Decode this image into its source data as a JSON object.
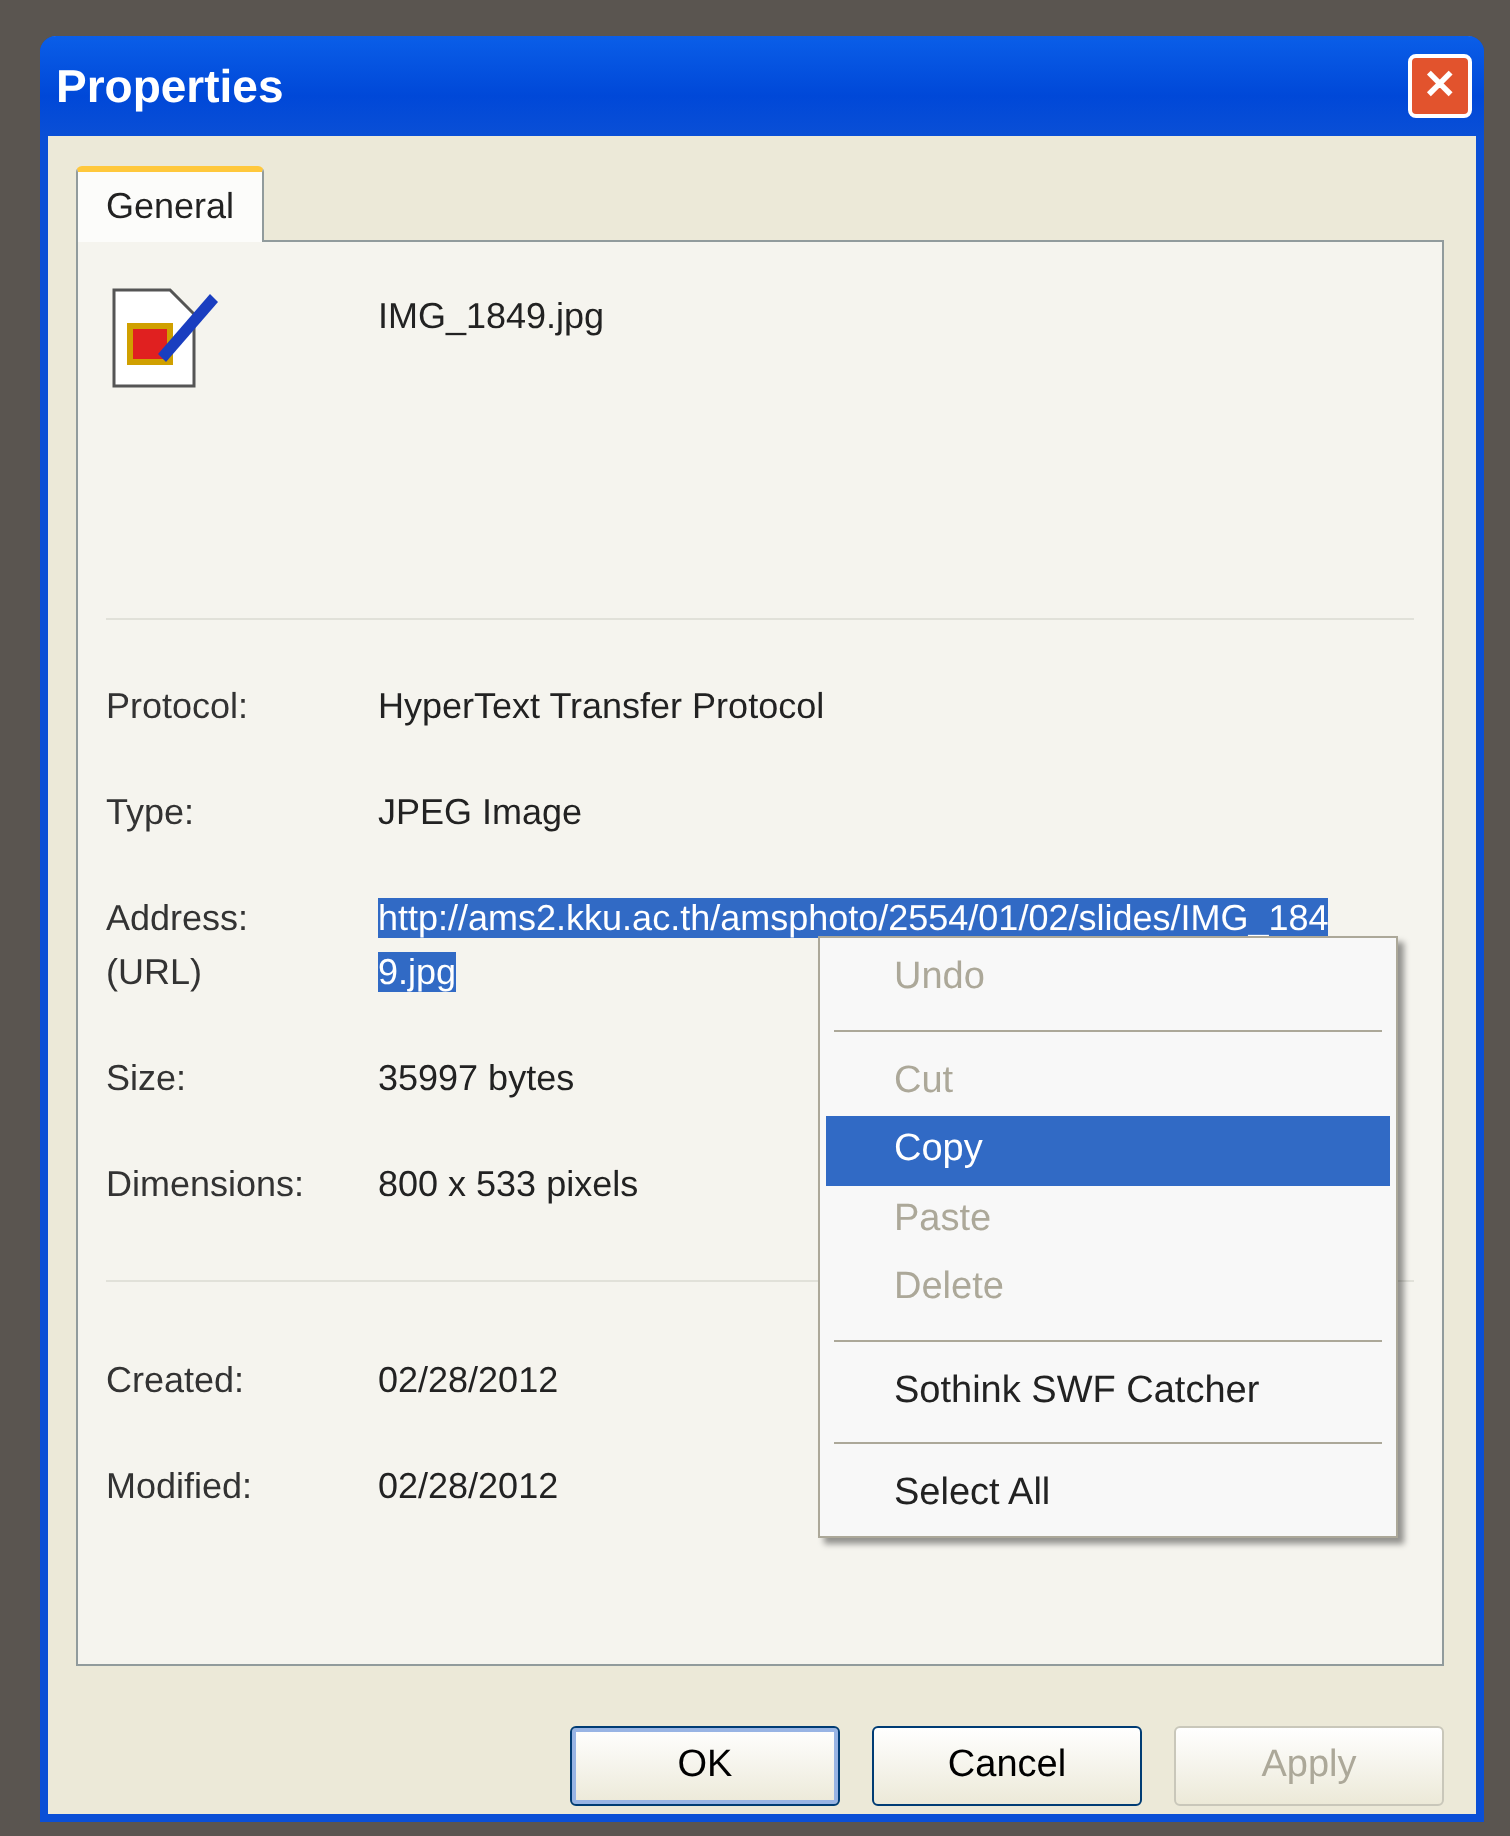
{
  "window": {
    "title": "Properties",
    "close": "✕"
  },
  "tabs": [
    {
      "label": "General",
      "selected": true
    }
  ],
  "file": {
    "name": "IMG_1849.jpg"
  },
  "details": [
    {
      "label": "Protocol:",
      "value": "HyperText Transfer Protocol",
      "selected": false
    },
    {
      "label": "Type:",
      "value": "JPEG Image",
      "selected": false
    },
    {
      "label": "Address:\n(URL)",
      "value": "http://ams2.kku.ac.th/amsphoto/2554/01/02/slides/IMG_1849.jpg",
      "selected": true
    },
    {
      "label": "Size:",
      "value": "35997 bytes",
      "selected": false
    },
    {
      "label": "Dimensions:",
      "value": "800  x  533  pixels",
      "selected": false
    }
  ],
  "dates": [
    {
      "label": "Created:",
      "value": "02/28/2012"
    },
    {
      "label": "Modified:",
      "value": "02/28/2012"
    }
  ],
  "context_menu": [
    {
      "kind": "item",
      "label": "Undo",
      "disabled": true,
      "selected": false
    },
    {
      "kind": "separator"
    },
    {
      "kind": "item",
      "label": "Cut",
      "disabled": true,
      "selected": false
    },
    {
      "kind": "item",
      "label": "Copy",
      "disabled": false,
      "selected": true
    },
    {
      "kind": "item",
      "label": "Paste",
      "disabled": true,
      "selected": false
    },
    {
      "kind": "item",
      "label": "Delete",
      "disabled": true,
      "selected": false
    },
    {
      "kind": "separator"
    },
    {
      "kind": "item",
      "label": "Sothink SWF Catcher",
      "disabled": false,
      "selected": false
    },
    {
      "kind": "separator"
    },
    {
      "kind": "item",
      "label": "Select All",
      "disabled": false,
      "selected": false
    }
  ],
  "buttons": [
    {
      "label": "OK",
      "disabled": false,
      "default": true
    },
    {
      "label": "Cancel",
      "disabled": false,
      "default": false
    },
    {
      "label": "Apply",
      "disabled": true,
      "default": false
    }
  ]
}
